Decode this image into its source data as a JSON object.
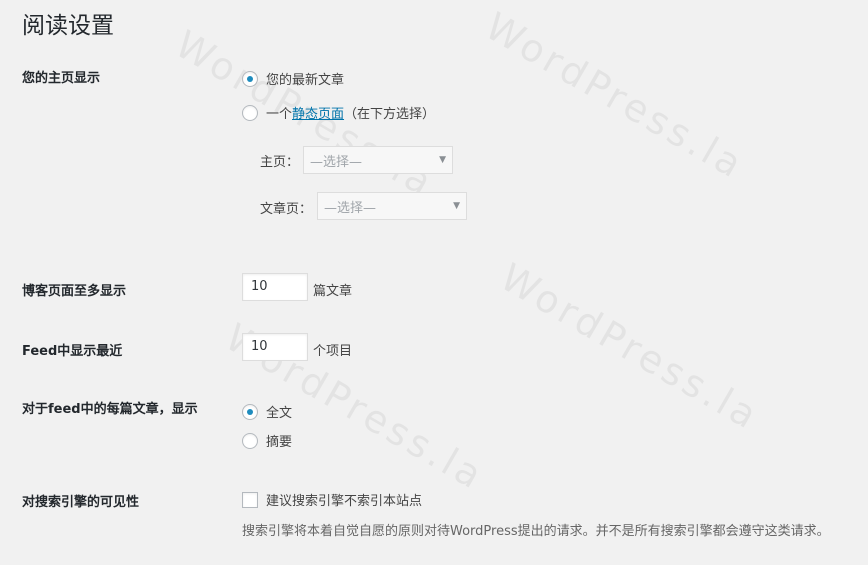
{
  "page": {
    "title": "阅读设置"
  },
  "front_page": {
    "label": "您的主页显示",
    "option_latest": "您的最新文章",
    "option_static_prefix": "一个",
    "option_static_link": "静态页面",
    "option_static_suffix": "（在下方选择）",
    "homepage_label": "主页：",
    "homepage_value": "—选择—",
    "posts_page_label": "文章页：",
    "posts_page_value": "—选择—"
  },
  "posts_per_page": {
    "label": "博客页面至多显示",
    "value": "10",
    "unit": "篇文章"
  },
  "feed_count": {
    "label": "Feed中显示最近",
    "value": "10",
    "unit": "个项目"
  },
  "feed_content": {
    "label": "对于feed中的每篇文章，显示",
    "option_full": "全文",
    "option_summary": "摘要"
  },
  "search_visibility": {
    "label": "对搜索引擎的可见性",
    "checkbox_label": "建议搜索引擎不索引本站点",
    "description": "搜索引擎将本着自觉自愿的原则对待WordPress提出的请求。并不是所有搜索引擎都会遵守这类请求。"
  },
  "watermark": "WordPress.la"
}
